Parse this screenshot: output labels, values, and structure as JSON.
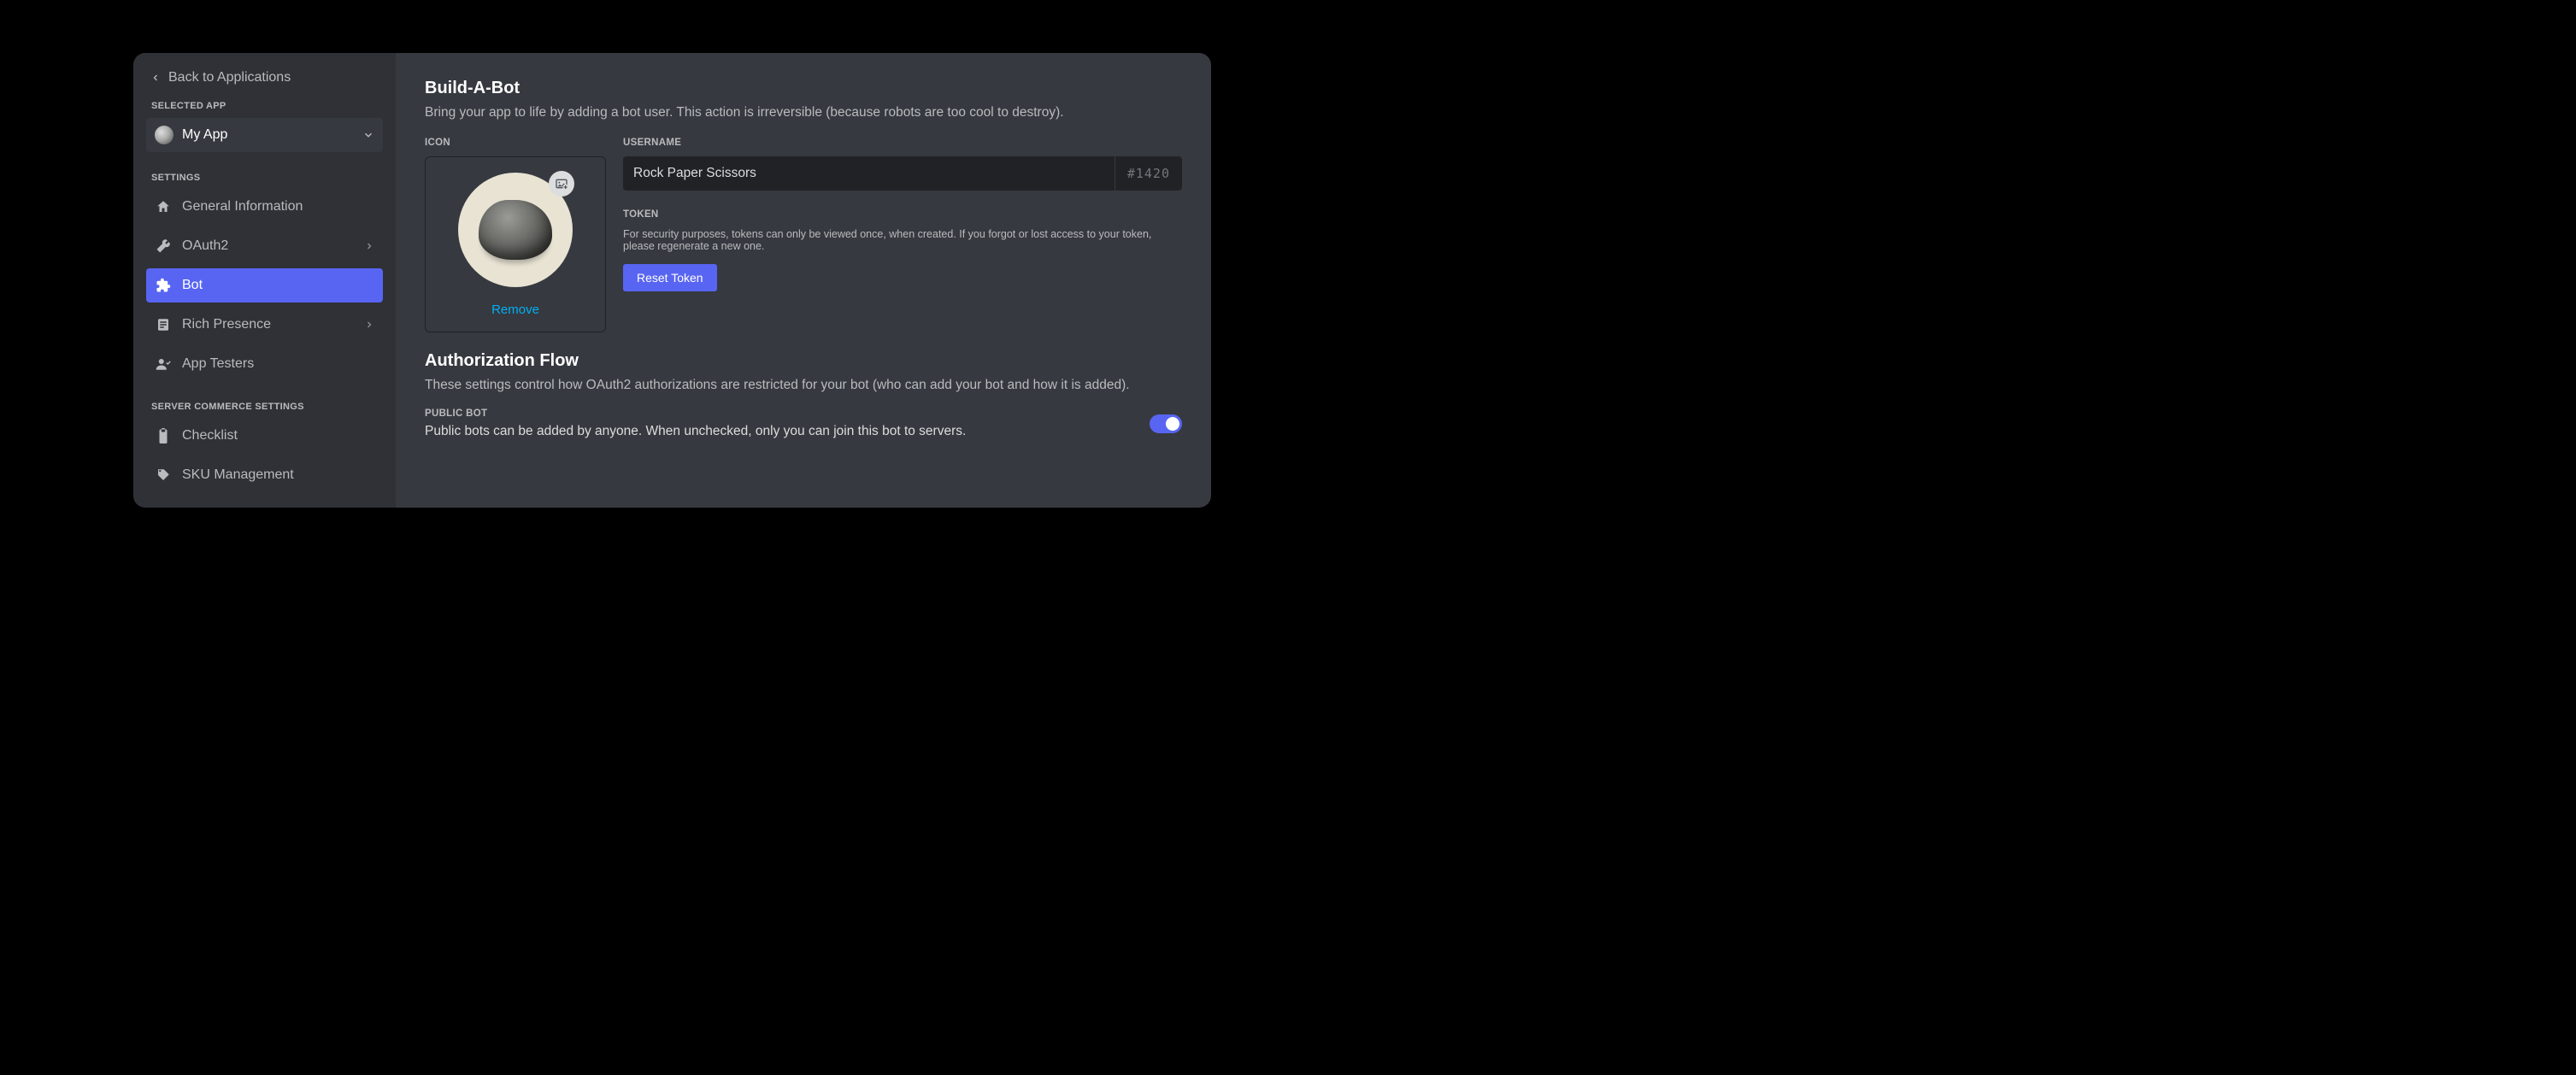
{
  "back_link": "Back to Applications",
  "selected_app_label": "SELECTED APP",
  "selected_app_name": "My App",
  "settings_label": "SETTINGS",
  "nav": [
    {
      "label": "General Information"
    },
    {
      "label": "OAuth2"
    },
    {
      "label": "Bot"
    },
    {
      "label": "Rich Presence"
    },
    {
      "label": "App Testers"
    }
  ],
  "commerce_label": "SERVER COMMERCE SETTINGS",
  "commerce_nav": [
    {
      "label": "Checklist"
    },
    {
      "label": "SKU Management"
    }
  ],
  "main": {
    "title": "Build-A-Bot",
    "subtitle": "Bring your app to life by adding a bot user. This action is irreversible (because robots are too cool to destroy).",
    "icon_label": "ICON",
    "remove_label": "Remove",
    "username_label": "USERNAME",
    "username_value": "Rock Paper Scissors",
    "discriminator": "#1420",
    "token_label": "TOKEN",
    "token_help": "For security purposes, tokens can only be viewed once, when created. If you forgot or lost access to your token, please regenerate a new one.",
    "reset_token": "Reset Token",
    "auth_title": "Authorization Flow",
    "auth_subtitle": "These settings control how OAuth2 authorizations are restricted for your bot (who can add your bot and how it is added).",
    "public_bot_label": "PUBLIC BOT",
    "public_bot_desc": "Public bots can be added by anyone. When unchecked, only you can join this bot to servers.",
    "public_bot_on": true
  }
}
